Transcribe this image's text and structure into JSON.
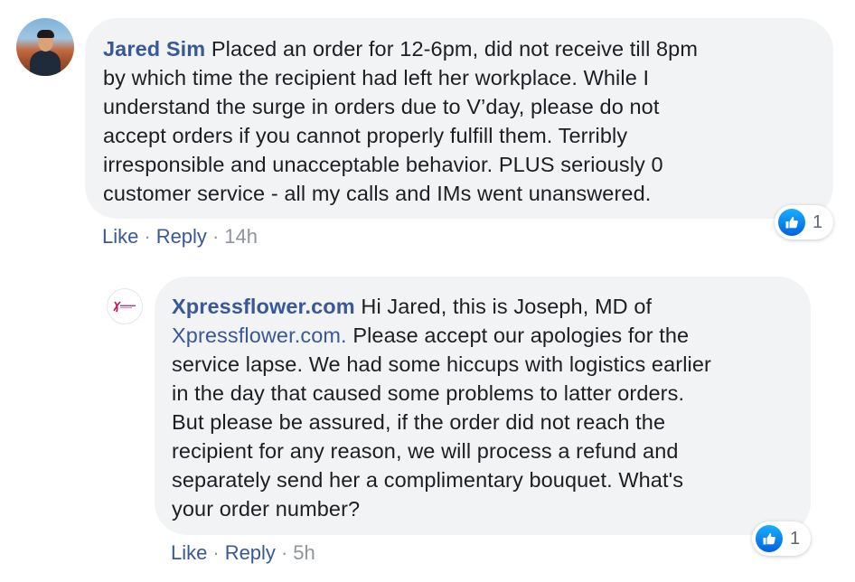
{
  "comments": [
    {
      "author": "Jared Sim",
      "lines": [
        "Placed an order for 12-6pm, did not receive till 8pm",
        "by which time the recipient had left her workplace. While I",
        "understand the surge in orders due to V’day, please do not",
        "accept orders if you cannot properly fulfill them. Terribly",
        "irresponsible and unacceptable behavior. PLUS seriously 0",
        "customer service - all my calls and IMs went unanswered."
      ],
      "like_label": "Like",
      "reply_label": "Reply",
      "timestamp": "14h",
      "reaction_count": "1",
      "avatar_icon": "profile-photo"
    },
    {
      "author": "Xpressflower.com",
      "first_line": "Hi Jared, this is Joseph, MD of",
      "link_text": "Xpressflower.com.",
      "link_line_rest": " Please accept our apologies for the",
      "lines": [
        "service lapse. We had some hiccups with logistics earlier",
        "in the day that caused some problems to latter orders.",
        "But please be assured, if the order did not reach the",
        "recipient for any reason, we will process a refund and",
        "separately send her a complimentary bouquet. What's",
        "your order number?"
      ],
      "like_label": "Like",
      "reply_label": "Reply",
      "timestamp": "5h",
      "reaction_count": "1",
      "avatar_icon": "xpressflower-logo"
    }
  ],
  "separator": "·",
  "colors": {
    "author": "#385898",
    "bubble": "#f2f3f5",
    "meta": "#90949c",
    "like_blue": "#1877f2"
  }
}
